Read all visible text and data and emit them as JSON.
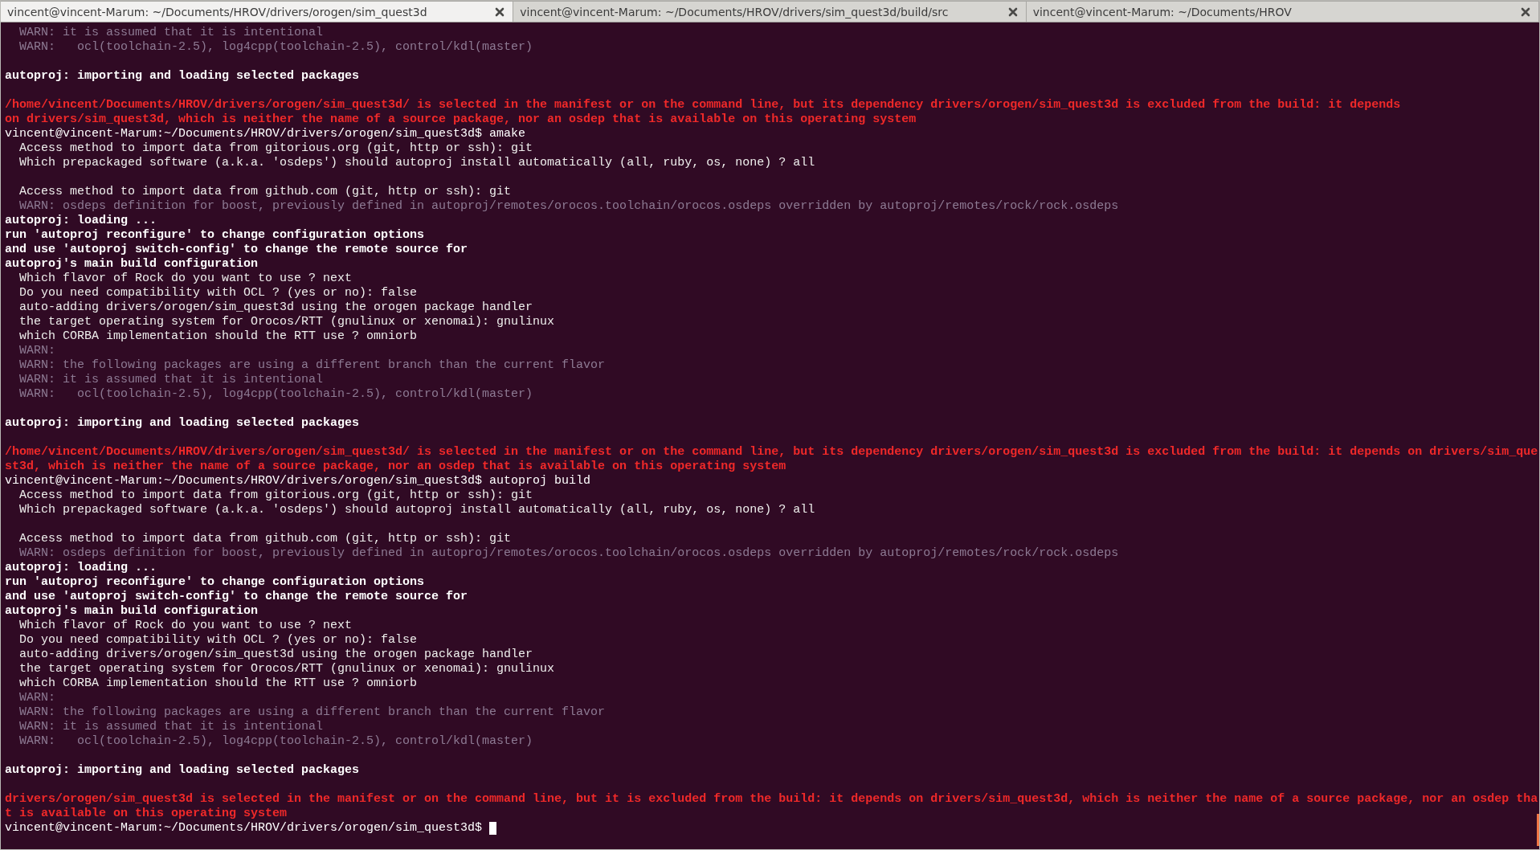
{
  "tabs": [
    {
      "title": "vincent@vincent-Marum: ~/Documents/HROV/drivers/orogen/sim_quest3d",
      "selected": true
    },
    {
      "title": "vincent@vincent-Marum: ~/Documents/HROV/drivers/sim_quest3d/build/src",
      "selected": false
    },
    {
      "title": "vincent@vincent-Marum: ~/Documents/HROV",
      "selected": false
    }
  ],
  "terminal": {
    "cursor": true,
    "lines": [
      {
        "kind": "warn",
        "text": "  WARN: it is assumed that it is intentional"
      },
      {
        "kind": "warn",
        "text": "  WARN:   ocl(toolchain-2.5), log4cpp(toolchain-2.5), control/kdl(master)"
      },
      {
        "kind": "blank"
      },
      {
        "kind": "bold",
        "text": "autoproj: importing and loading selected packages"
      },
      {
        "kind": "blank"
      },
      {
        "kind": "error",
        "text": "/home/vincent/Documents/HROV/drivers/orogen/sim_quest3d/ is selected in the manifest or on the command line, but its dependency drivers/orogen/sim_quest3d is excluded from the build: it depends"
      },
      {
        "kind": "error",
        "text": "on drivers/sim_quest3d, which is neither the name of a source package, nor an osdep that is available on this operating system"
      },
      {
        "kind": "prompt",
        "text": "vincent@vincent-Marum:~/Documents/HROV/drivers/orogen/sim_quest3d$ amake"
      },
      {
        "kind": "output",
        "text": "  Access method to import data from gitorious.org (git, http or ssh): git"
      },
      {
        "kind": "output",
        "text": "  Which prepackaged software (a.k.a. 'osdeps') should autoproj install automatically (all, ruby, os, none) ? all"
      },
      {
        "kind": "blank"
      },
      {
        "kind": "output",
        "text": "  Access method to import data from github.com (git, http or ssh): git"
      },
      {
        "kind": "warn",
        "text": "  WARN: osdeps definition for boost, previously defined in autoproj/remotes/orocos.toolchain/orocos.osdeps overridden by autoproj/remotes/rock/rock.osdeps"
      },
      {
        "kind": "bold",
        "text": "autoproj: loading ..."
      },
      {
        "kind": "bold",
        "text": "run 'autoproj reconfigure' to change configuration options"
      },
      {
        "kind": "bold",
        "text": "and use 'autoproj switch-config' to change the remote source for"
      },
      {
        "kind": "bold",
        "text": "autoproj's main build configuration"
      },
      {
        "kind": "output",
        "text": "  Which flavor of Rock do you want to use ? next"
      },
      {
        "kind": "output",
        "text": "  Do you need compatibility with OCL ? (yes or no): false"
      },
      {
        "kind": "output",
        "text": "  auto-adding drivers/orogen/sim_quest3d using the orogen package handler"
      },
      {
        "kind": "output",
        "text": "  the target operating system for Orocos/RTT (gnulinux or xenomai): gnulinux"
      },
      {
        "kind": "output",
        "text": "  which CORBA implementation should the RTT use ? omniorb"
      },
      {
        "kind": "warn",
        "text": "  WARN:"
      },
      {
        "kind": "warn",
        "text": "  WARN: the following packages are using a different branch than the current flavor"
      },
      {
        "kind": "warn",
        "text": "  WARN: it is assumed that it is intentional"
      },
      {
        "kind": "warn",
        "text": "  WARN:   ocl(toolchain-2.5), log4cpp(toolchain-2.5), control/kdl(master)"
      },
      {
        "kind": "blank"
      },
      {
        "kind": "bold",
        "text": "autoproj: importing and loading selected packages"
      },
      {
        "kind": "blank"
      },
      {
        "kind": "error",
        "text": "/home/vincent/Documents/HROV/drivers/orogen/sim_quest3d/ is selected in the manifest or on the command line, but its dependency drivers/orogen/sim_quest3d is excluded from the build: it depends on drivers/sim_que"
      },
      {
        "kind": "error",
        "text": "st3d, which is neither the name of a source package, nor an osdep that is available on this operating system"
      },
      {
        "kind": "prompt",
        "text": "vincent@vincent-Marum:~/Documents/HROV/drivers/orogen/sim_quest3d$ autoproj build"
      },
      {
        "kind": "output",
        "text": "  Access method to import data from gitorious.org (git, http or ssh): git"
      },
      {
        "kind": "output",
        "text": "  Which prepackaged software (a.k.a. 'osdeps') should autoproj install automatically (all, ruby, os, none) ? all"
      },
      {
        "kind": "blank"
      },
      {
        "kind": "output",
        "text": "  Access method to import data from github.com (git, http or ssh): git"
      },
      {
        "kind": "warn",
        "text": "  WARN: osdeps definition for boost, previously defined in autoproj/remotes/orocos.toolchain/orocos.osdeps overridden by autoproj/remotes/rock/rock.osdeps"
      },
      {
        "kind": "bold",
        "text": "autoproj: loading ..."
      },
      {
        "kind": "bold",
        "text": "run 'autoproj reconfigure' to change configuration options"
      },
      {
        "kind": "bold",
        "text": "and use 'autoproj switch-config' to change the remote source for"
      },
      {
        "kind": "bold",
        "text": "autoproj's main build configuration"
      },
      {
        "kind": "output",
        "text": "  Which flavor of Rock do you want to use ? next"
      },
      {
        "kind": "output",
        "text": "  Do you need compatibility with OCL ? (yes or no): false"
      },
      {
        "kind": "output",
        "text": "  auto-adding drivers/orogen/sim_quest3d using the orogen package handler"
      },
      {
        "kind": "output",
        "text": "  the target operating system for Orocos/RTT (gnulinux or xenomai): gnulinux"
      },
      {
        "kind": "output",
        "text": "  which CORBA implementation should the RTT use ? omniorb"
      },
      {
        "kind": "warn",
        "text": "  WARN:"
      },
      {
        "kind": "warn",
        "text": "  WARN: the following packages are using a different branch than the current flavor"
      },
      {
        "kind": "warn",
        "text": "  WARN: it is assumed that it is intentional"
      },
      {
        "kind": "warn",
        "text": "  WARN:   ocl(toolchain-2.5), log4cpp(toolchain-2.5), control/kdl(master)"
      },
      {
        "kind": "blank"
      },
      {
        "kind": "bold",
        "text": "autoproj: importing and loading selected packages"
      },
      {
        "kind": "blank"
      },
      {
        "kind": "error",
        "text": "drivers/orogen/sim_quest3d is selected in the manifest or on the command line, but it is excluded from the build: it depends on drivers/sim_quest3d, which is neither the name of a source package, nor an osdep tha"
      },
      {
        "kind": "error",
        "text": "t is available on this operating system"
      },
      {
        "kind": "prompt",
        "text": "vincent@vincent-Marum:~/Documents/HROV/drivers/orogen/sim_quest3d$ "
      }
    ]
  }
}
